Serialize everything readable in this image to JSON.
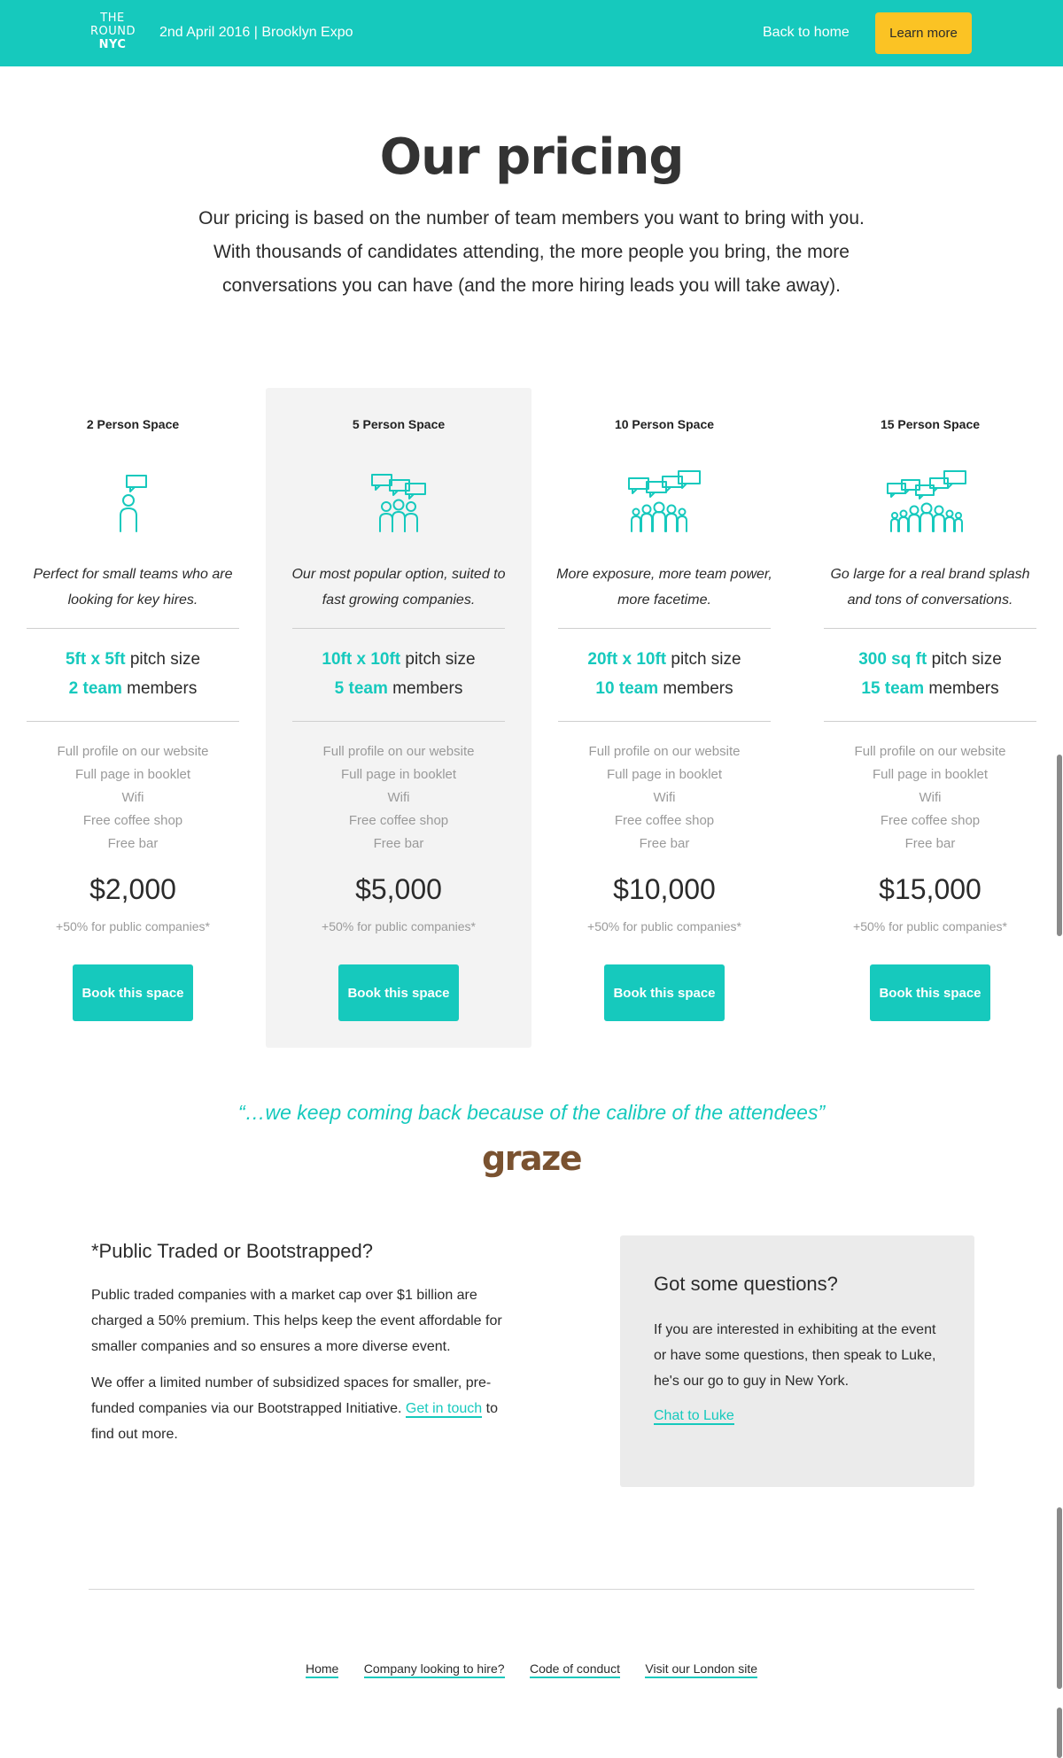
{
  "header": {
    "logo": [
      "THE",
      "ROUND",
      "NYC"
    ],
    "event_info": "2nd April 2016 | Brooklyn Expo",
    "back_home": "Back to home",
    "learn_more": "Learn more"
  },
  "intro": {
    "title": "Our pricing",
    "text": "Our pricing is based on the number of team members you want to bring with you. With thousands of candidates attending, the more people you bring, the more conversations you can have (and the more hiring leads you will take away)."
  },
  "plans": [
    {
      "name": "2 Person Space",
      "icon": "two-person-icon",
      "description": "Perfect for small teams who are looking for key hires.",
      "pitch_value": "5ft x 5ft",
      "pitch_label": " pitch size",
      "team_value": "2 team",
      "team_label": " members",
      "features": [
        "Full profile on our website",
        "Full page in booklet",
        "Wifi",
        "Free coffee shop",
        "Free bar"
      ],
      "price": "$2,000",
      "note": "+50% for public companies*",
      "button": "Book this space",
      "featured": false
    },
    {
      "name": "5 Person Space",
      "icon": "five-person-icon",
      "description": "Our most popular option, suited to fast growing companies.",
      "pitch_value": "10ft x 10ft",
      "pitch_label": " pitch size",
      "team_value": "5 team",
      "team_label": " members",
      "features": [
        "Full profile on our website",
        "Full page in booklet",
        "Wifi",
        "Free coffee shop",
        "Free bar"
      ],
      "price": "$5,000",
      "note": "+50% for public companies*",
      "button": "Book this space",
      "featured": true
    },
    {
      "name": "10 Person Space",
      "icon": "ten-person-icon",
      "description": "More exposure, more team power, more facetime.",
      "pitch_value": "20ft x 10ft",
      "pitch_label": " pitch size",
      "team_value": "10 team",
      "team_label": " members",
      "features": [
        "Full profile on our website",
        "Full page in booklet",
        "Wifi",
        "Free coffee shop",
        "Free bar"
      ],
      "price": "$10,000",
      "note": "+50% for public companies*",
      "button": "Book this space",
      "featured": false
    },
    {
      "name": "15 Person Space",
      "icon": "fifteen-person-icon",
      "description": "Go large for a real brand splash and tons of conversations.",
      "pitch_value": "300 sq ft",
      "pitch_label": " pitch size",
      "team_value": "15 team",
      "team_label": " members",
      "features": [
        "Full profile on our website",
        "Full page in booklet",
        "Wifi",
        "Free coffee shop",
        "Free bar"
      ],
      "price": "$15,000",
      "note": "+50% for public companies*",
      "button": "Book this space",
      "featured": false
    }
  ],
  "testimonial": {
    "quote": "“…we keep coming back because of the calibre of the attendees”",
    "brand": "graze"
  },
  "public": {
    "title": "*Public Traded or Bootstrapped?",
    "p1": "Public traded companies with a market cap over $1 billion are charged a 50% premium. This helps keep the event affordable for smaller companies and so ensures a more diverse event.",
    "p2_before": "We offer a limited number of subsidized spaces for smaller, pre-funded companies via our Bootstrapped Initiative. ",
    "p2_link": "Get in touch",
    "p2_after": " to find out more."
  },
  "questions": {
    "title": "Got some questions?",
    "text": "If you are interested in exhibiting at the event or have some questions, then speak to Luke, he's our go to guy in New York.",
    "link": "Chat to Luke"
  },
  "footer": {
    "links": [
      "Home",
      "Company looking to hire?",
      "Code of conduct",
      "Visit our London site"
    ]
  },
  "colors": {
    "accent": "#16c9bd",
    "button_yellow": "#fbc324",
    "graze_brown": "#7a5230"
  }
}
